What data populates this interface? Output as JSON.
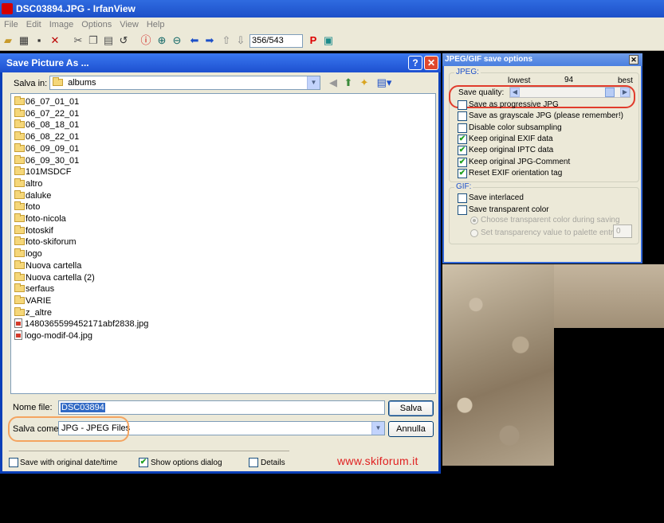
{
  "app": {
    "title": "DSC03894.JPG - IrfanView"
  },
  "menu": [
    "File",
    "Edit",
    "Image",
    "Options",
    "View",
    "Help"
  ],
  "toolbar": {
    "page_counter": "356/543"
  },
  "save_dialog": {
    "title": "Save Picture As ...",
    "save_in_label": "Salva in:",
    "save_in_value": "albums",
    "files": [
      {
        "name": "06_07_01_01",
        "type": "folder"
      },
      {
        "name": "06_07_22_01",
        "type": "folder"
      },
      {
        "name": "06_08_18_01",
        "type": "folder"
      },
      {
        "name": "06_08_22_01",
        "type": "folder"
      },
      {
        "name": "06_09_09_01",
        "type": "folder"
      },
      {
        "name": "06_09_30_01",
        "type": "folder"
      },
      {
        "name": "101MSDCF",
        "type": "folder"
      },
      {
        "name": "altro",
        "type": "folder"
      },
      {
        "name": "daluke",
        "type": "folder"
      },
      {
        "name": "foto",
        "type": "folder"
      },
      {
        "name": "foto-nicola",
        "type": "folder"
      },
      {
        "name": "fotoskif",
        "type": "folder"
      },
      {
        "name": "foto-skiforum",
        "type": "folder"
      },
      {
        "name": "logo",
        "type": "folder"
      },
      {
        "name": "Nuova cartella",
        "type": "folder"
      },
      {
        "name": "Nuova cartella (2)",
        "type": "folder"
      },
      {
        "name": "serfaus",
        "type": "folder"
      },
      {
        "name": "VARIE",
        "type": "folder"
      },
      {
        "name": "z_altre",
        "type": "folder"
      },
      {
        "name": "1480365599452171abf2838.jpg",
        "type": "jpg"
      },
      {
        "name": "logo-modif-04.jpg",
        "type": "jpg"
      }
    ],
    "filename_label": "Nome file:",
    "filename_value": "DSC03894",
    "saveas_label": "Salva come:",
    "saveas_value": "JPG - JPEG Files",
    "save_button": "Salva",
    "cancel_button": "Annulla",
    "opt_original_date": "Save with original date/time",
    "opt_show_options": "Show options dialog",
    "opt_details": "Details",
    "watermark": "www.skiforum.it"
  },
  "options_panel": {
    "title": "JPEG/GIF save options",
    "jpeg_group": "JPEG:",
    "quality_lowest": "lowest",
    "quality_value": "94",
    "quality_best": "best",
    "quality_label": "Save quality:",
    "quality_level": 94,
    "jpeg_options": [
      {
        "label": "Save as progressive JPG",
        "checked": false
      },
      {
        "label": "Save as grayscale JPG (please remember!)",
        "checked": false
      },
      {
        "label": "Disable color subsampling",
        "checked": false
      },
      {
        "label": "Keep original EXIF data",
        "checked": true
      },
      {
        "label": "Keep original IPTC data",
        "checked": true
      },
      {
        "label": "Keep original JPG-Comment",
        "checked": true
      },
      {
        "label": "Reset EXIF orientation tag",
        "checked": true
      }
    ],
    "gif_group": "GIF:",
    "gif_options": [
      {
        "label": "Save interlaced",
        "checked": false
      },
      {
        "label": "Save transparent color",
        "checked": false
      }
    ],
    "radio_options": [
      {
        "label": "Choose transparent color during saving",
        "selected": true
      },
      {
        "label": "Set transparency value to palette entry:",
        "selected": false
      }
    ],
    "palette_entry": "0"
  },
  "colors": {
    "title_blue": "#1d50d0",
    "highlight_red": "#e13c2c",
    "highlight_orange": "#f4a460",
    "watermark_red": "#e02020"
  }
}
